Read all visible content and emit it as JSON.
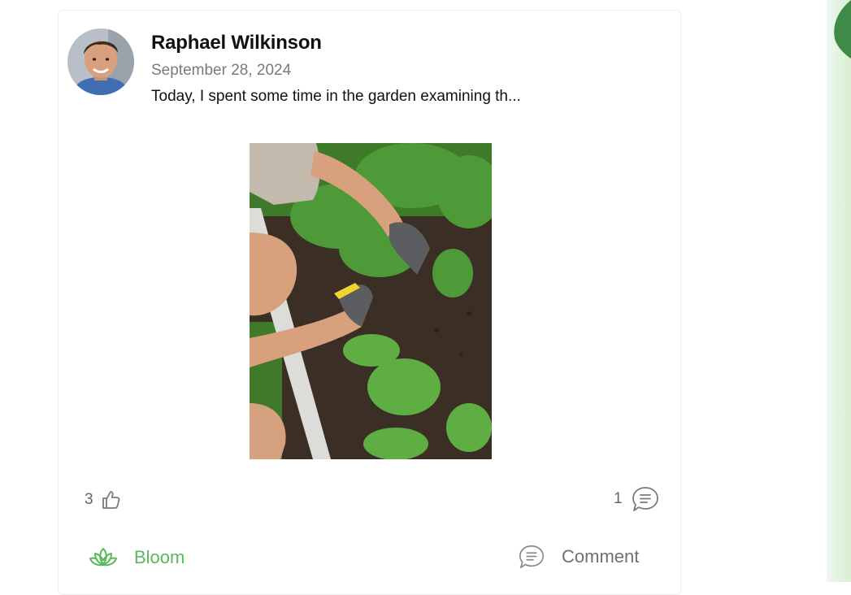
{
  "post": {
    "author": "Raphael Wilkinson",
    "date": "September 28, 2024",
    "text": "Today, I spent some time in the garden examining th...",
    "likes_count": "3",
    "comments_count": "1"
  },
  "actions": {
    "bloom_label": "Bloom",
    "comment_label": "Comment"
  },
  "icons": {
    "like": "thumbs-up-icon",
    "comments": "comment-bubble-icon",
    "bloom": "lotus-icon"
  },
  "colors": {
    "accent": "#5cb85c",
    "muted": "#7a7a7a"
  }
}
